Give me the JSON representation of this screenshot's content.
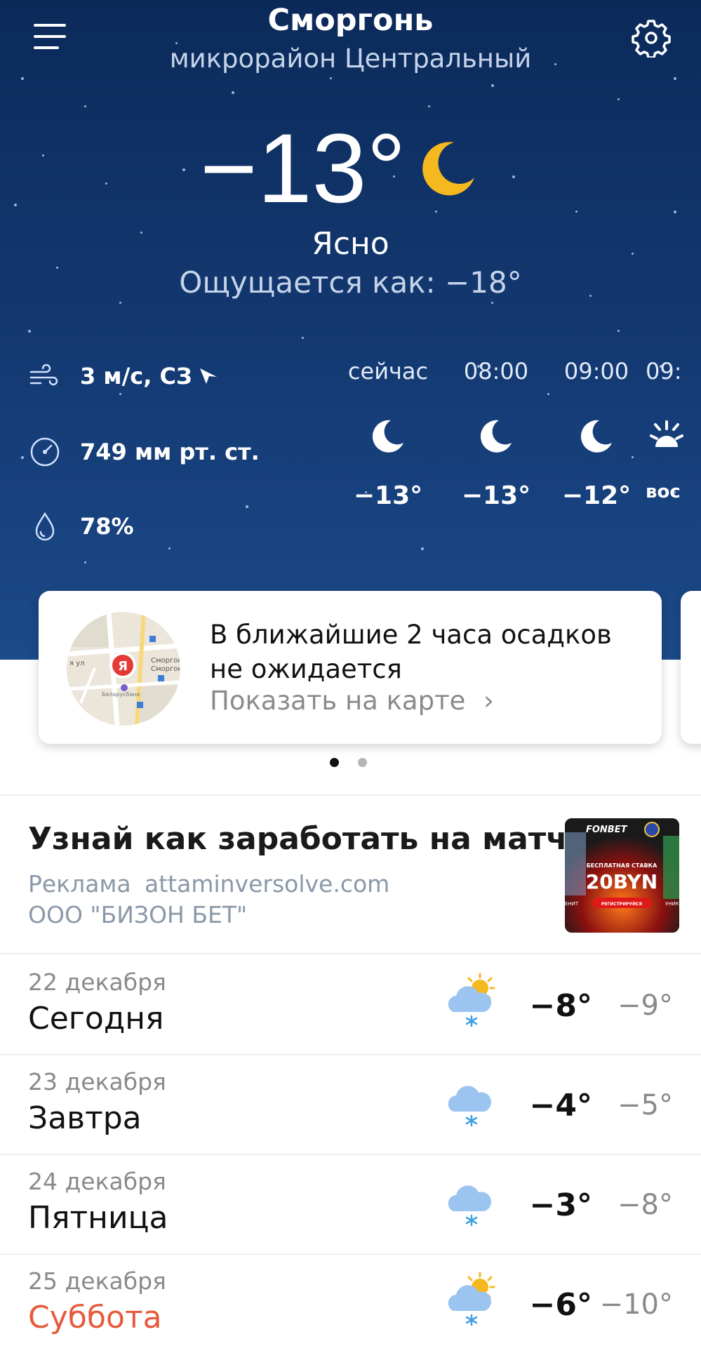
{
  "header": {
    "city": "Сморгонь",
    "district": "микрорайон Центральный"
  },
  "current": {
    "temperature": "−13°",
    "condition": "Ясно",
    "feels_like": "Ощущается как: −18°",
    "wind": "3 м/с, СЗ",
    "pressure": "749 мм рт. ст.",
    "humidity": "78%"
  },
  "hourly": [
    {
      "time": "сейчас",
      "icon": "moon-icon",
      "temp": "−13°"
    },
    {
      "time": "08:00",
      "icon": "moon-icon",
      "temp": "−13°"
    },
    {
      "time": "09:00",
      "icon": "moon-icon",
      "temp": "−12°"
    },
    {
      "time": "09:",
      "icon": "sunrise-icon",
      "temp": "вос"
    }
  ],
  "nowcast": {
    "title": "В ближайшие 2 часа осадков не ожидается",
    "link": "Показать на карте",
    "map_labels": {
      "city": "Сморгонь",
      "city2": "Сморгон",
      "street": "я ул",
      "bank": "Беларусбанк",
      "pin": "Я"
    }
  },
  "ad": {
    "title": "Узнай как заработать на матчах!",
    "label": "Реклама",
    "domain": "attaminversolve.com",
    "company": "ООО \"БИЗОН БЕТ\"",
    "banner": {
      "brand": "FONBET",
      "promo": "БЕСПЛАТНАЯ СТАВКА",
      "amount": "20BYN",
      "button": "РЕГИСТРИРУЙСЯ",
      "side_left": "ЕНИТ",
      "side_right": "УНИК"
    }
  },
  "days": [
    {
      "date": "22 декабря",
      "name": "Сегодня",
      "icon": "partly-cloudy-snow-icon",
      "max": "−8°",
      "min": "−9°",
      "weekend": false
    },
    {
      "date": "23 декабря",
      "name": "Завтра",
      "icon": "cloud-snow-icon",
      "max": "−4°",
      "min": "−5°",
      "weekend": false
    },
    {
      "date": "24 декабря",
      "name": "Пятница",
      "icon": "cloud-snow-icon",
      "max": "−3°",
      "min": "−8°",
      "weekend": false
    },
    {
      "date": "25 декабря",
      "name": "Суббота",
      "icon": "partly-cloudy-snow-icon",
      "max": "−6°",
      "min": "−10°",
      "weekend": true
    }
  ],
  "colors": {
    "hero_top": "#0b2a5a",
    "hero_bottom": "#1b4a89",
    "sun": "#f5b81e",
    "cloud": "#9cc4f0",
    "weekend": "#e65a3c"
  }
}
